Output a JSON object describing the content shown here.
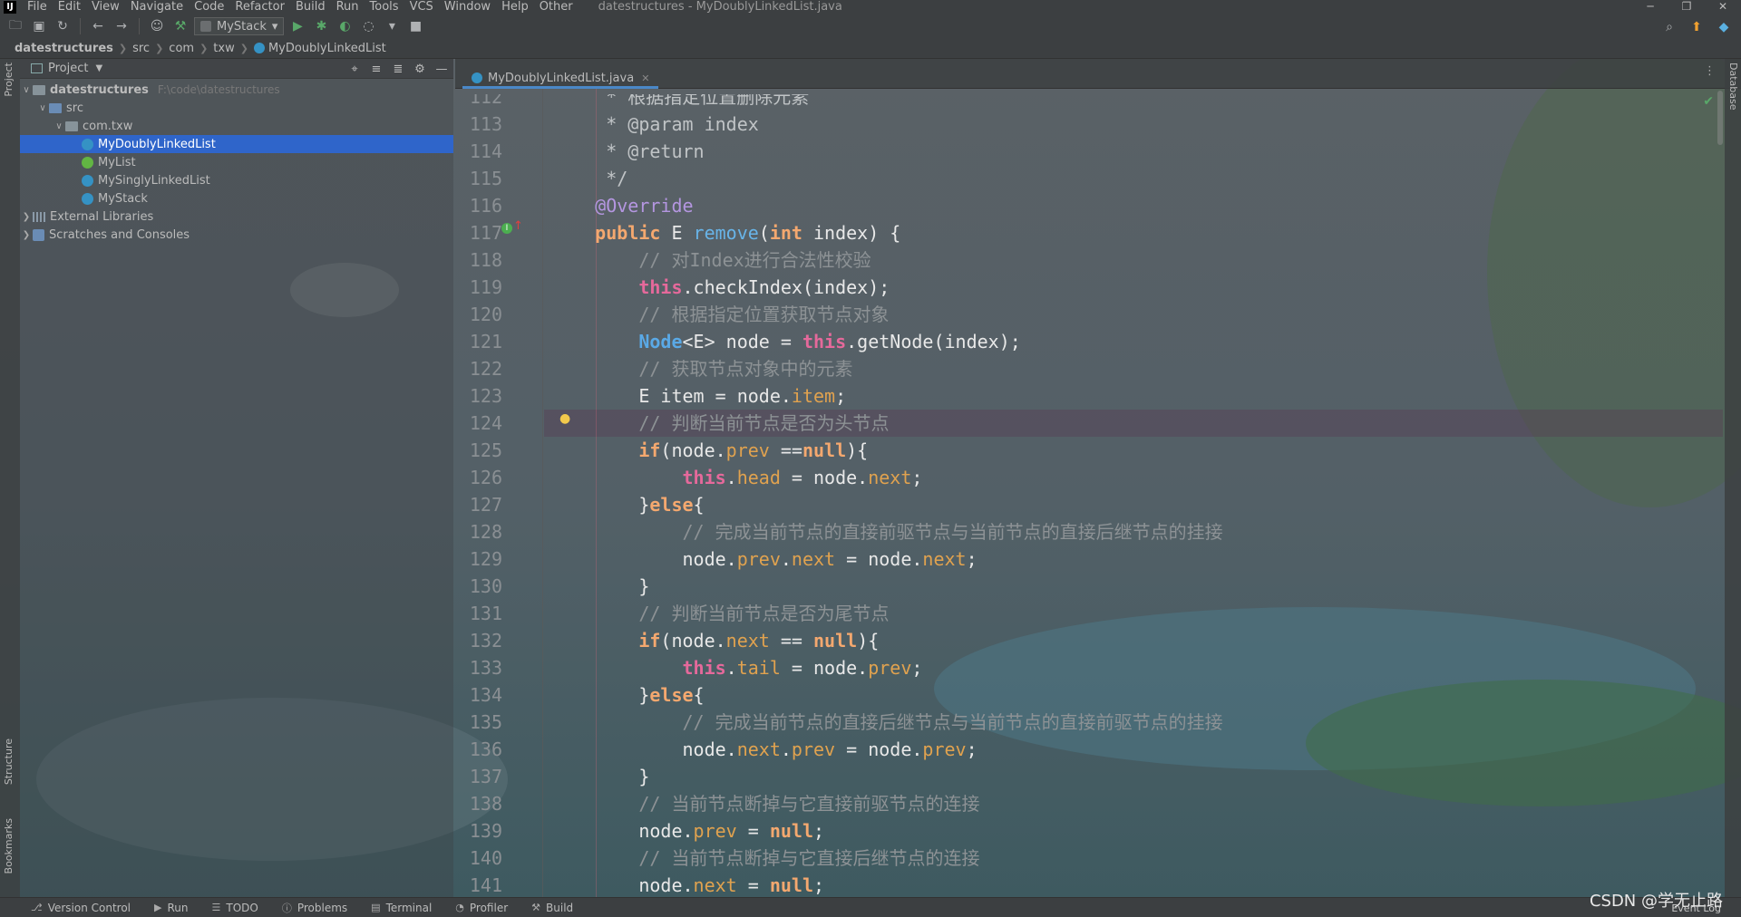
{
  "menubar": {
    "logo": "IJ",
    "items": [
      "File",
      "Edit",
      "View",
      "Navigate",
      "Code",
      "Refactor",
      "Build",
      "Run",
      "Tools",
      "VCS",
      "Window",
      "Help",
      "Other"
    ],
    "window_title": "datestructures - MyDoublyLinkedList.java",
    "controls": [
      "─",
      "❐",
      "✕"
    ]
  },
  "toolbar": {
    "run_config": "MyStack"
  },
  "breadcrumb": [
    "datestructures",
    "src",
    "com",
    "txw",
    "MyDoublyLinkedList"
  ],
  "left_strip": {
    "top": "Project",
    "middle": "Structure",
    "bottom": "Bookmarks"
  },
  "right_strip": {
    "top": "Database"
  },
  "project": {
    "title": "Project",
    "tree": [
      {
        "label": "datestructures",
        "path": "F:\\code\\datestructures",
        "type": "root",
        "indent": 0,
        "expanded": true
      },
      {
        "label": "src",
        "type": "src",
        "indent": 1,
        "expanded": true
      },
      {
        "label": "com.txw",
        "type": "package",
        "indent": 2,
        "expanded": true
      },
      {
        "label": "MyDoublyLinkedList",
        "type": "class",
        "indent": 3,
        "selected": true
      },
      {
        "label": "MyList",
        "type": "interface",
        "indent": 3
      },
      {
        "label": "MySinglyLinkedList",
        "type": "class",
        "indent": 3
      },
      {
        "label": "MyStack",
        "type": "class",
        "indent": 3
      },
      {
        "label": "External Libraries",
        "type": "lib",
        "indent": 0,
        "expanded": false
      },
      {
        "label": "Scratches and Consoles",
        "type": "scratch",
        "indent": 0,
        "expanded": false
      }
    ]
  },
  "editor": {
    "tab": "MyDoublyLinkedList.java",
    "first_partial_line": {
      "n": "112",
      "text": "     * 根据指定位置删除元素"
    },
    "lines": [
      {
        "n": "113",
        "seg": [
          [
            "doc",
            "     * @param index"
          ]
        ]
      },
      {
        "n": "114",
        "seg": [
          [
            "doc",
            "     * @return"
          ]
        ]
      },
      {
        "n": "115",
        "seg": [
          [
            "doc",
            "     */"
          ]
        ]
      },
      {
        "n": "116",
        "seg": [
          [
            "ann",
            "    @Override"
          ]
        ]
      },
      {
        "n": "117",
        "seg": [
          [
            "kw2",
            "    public "
          ],
          [
            "pl",
            "E "
          ],
          [
            "fn",
            "remove"
          ],
          [
            "pl",
            "("
          ],
          [
            "kw2",
            "int "
          ],
          [
            "pl",
            "index) {"
          ]
        ]
      },
      {
        "n": "118",
        "seg": [
          [
            "cm",
            "        // 对Index进行合法性校验"
          ]
        ]
      },
      {
        "n": "119",
        "seg": [
          [
            "kw",
            "        this"
          ],
          [
            "pl",
            ".checkIndex(index);"
          ]
        ]
      },
      {
        "n": "120",
        "seg": [
          [
            "cm",
            "        // 根据指定位置获取节点对象"
          ]
        ]
      },
      {
        "n": "121",
        "seg": [
          [
            "type",
            "        Node"
          ],
          [
            "pl",
            "<E> node = "
          ],
          [
            "kw",
            "this"
          ],
          [
            "pl",
            ".getNode(index);"
          ]
        ]
      },
      {
        "n": "122",
        "seg": [
          [
            "cm",
            "        // 获取节点对象中的元素"
          ]
        ]
      },
      {
        "n": "123",
        "seg": [
          [
            "pl",
            "        E item = node."
          ],
          [
            "fld",
            "item"
          ],
          [
            "pl",
            ";"
          ]
        ]
      },
      {
        "n": "124",
        "seg": [
          [
            "cm",
            "        // 判断当前节点是否为头节点"
          ]
        ]
      },
      {
        "n": "125",
        "seg": [
          [
            "kw2",
            "        if"
          ],
          [
            "pl",
            "(node."
          ],
          [
            "fld",
            "prev"
          ],
          [
            "pl",
            " =="
          ],
          [
            "kw2",
            "null"
          ],
          [
            "pl",
            "){"
          ]
        ]
      },
      {
        "n": "126",
        "seg": [
          [
            "kw",
            "            this"
          ],
          [
            "pl",
            "."
          ],
          [
            "fld",
            "head"
          ],
          [
            "pl",
            " = node."
          ],
          [
            "fld",
            "next"
          ],
          [
            "pl",
            ";"
          ]
        ]
      },
      {
        "n": "127",
        "seg": [
          [
            "pl",
            "        }"
          ],
          [
            "kw2",
            "else"
          ],
          [
            "pl",
            "{"
          ]
        ]
      },
      {
        "n": "128",
        "seg": [
          [
            "cm",
            "            // 完成当前节点的直接前驱节点与当前节点的直接后继节点的挂接"
          ]
        ]
      },
      {
        "n": "129",
        "seg": [
          [
            "pl",
            "            node."
          ],
          [
            "fld",
            "prev"
          ],
          [
            "pl",
            "."
          ],
          [
            "fld",
            "next"
          ],
          [
            "pl",
            " = node."
          ],
          [
            "fld",
            "next"
          ],
          [
            "pl",
            ";"
          ]
        ]
      },
      {
        "n": "130",
        "seg": [
          [
            "pl",
            "        }"
          ]
        ]
      },
      {
        "n": "131",
        "seg": [
          [
            "cm",
            "        // 判断当前节点是否为尾节点"
          ]
        ]
      },
      {
        "n": "132",
        "seg": [
          [
            "kw2",
            "        if"
          ],
          [
            "pl",
            "(node."
          ],
          [
            "fld",
            "next"
          ],
          [
            "pl",
            " == "
          ],
          [
            "kw2",
            "null"
          ],
          [
            "pl",
            "){"
          ]
        ]
      },
      {
        "n": "133",
        "seg": [
          [
            "kw",
            "            this"
          ],
          [
            "pl",
            "."
          ],
          [
            "fld",
            "tail"
          ],
          [
            "pl",
            " = node."
          ],
          [
            "fld",
            "prev"
          ],
          [
            "pl",
            ";"
          ]
        ]
      },
      {
        "n": "134",
        "seg": [
          [
            "pl",
            "        }"
          ],
          [
            "kw2",
            "else"
          ],
          [
            "pl",
            "{"
          ]
        ]
      },
      {
        "n": "135",
        "seg": [
          [
            "cm",
            "            // 完成当前节点的直接后继节点与当前节点的直接前驱节点的挂接"
          ]
        ]
      },
      {
        "n": "136",
        "seg": [
          [
            "pl",
            "            node."
          ],
          [
            "fld",
            "next"
          ],
          [
            "pl",
            "."
          ],
          [
            "fld",
            "prev"
          ],
          [
            "pl",
            " = node."
          ],
          [
            "fld",
            "prev"
          ],
          [
            "pl",
            ";"
          ]
        ]
      },
      {
        "n": "137",
        "seg": [
          [
            "pl",
            "        }"
          ]
        ]
      },
      {
        "n": "138",
        "seg": [
          [
            "cm",
            "        // 当前节点断掉与它直接前驱节点的连接"
          ]
        ]
      },
      {
        "n": "139",
        "seg": [
          [
            "pl",
            "        node."
          ],
          [
            "fld",
            "prev"
          ],
          [
            "pl",
            " = "
          ],
          [
            "kw2",
            "null"
          ],
          [
            "pl",
            ";"
          ]
        ]
      },
      {
        "n": "140",
        "seg": [
          [
            "cm",
            "        // 当前节点断掉与它直接后继节点的连接"
          ]
        ]
      },
      {
        "n": "141",
        "seg": [
          [
            "pl",
            "        node."
          ],
          [
            "fld",
            "next"
          ],
          [
            "pl",
            " = "
          ],
          [
            "kw2",
            "null"
          ],
          [
            "pl",
            ";"
          ]
        ]
      }
    ],
    "highlighted_line": "124"
  },
  "statusbar": {
    "items": [
      "Version Control",
      "Run",
      "TODO",
      "Problems",
      "Terminal",
      "Profiler",
      "Build"
    ],
    "event_log": "Event Log"
  },
  "watermark": "CSDN @学无止路",
  "colors": {
    "accent": "#2f65ca",
    "background": "#3c3f41"
  }
}
